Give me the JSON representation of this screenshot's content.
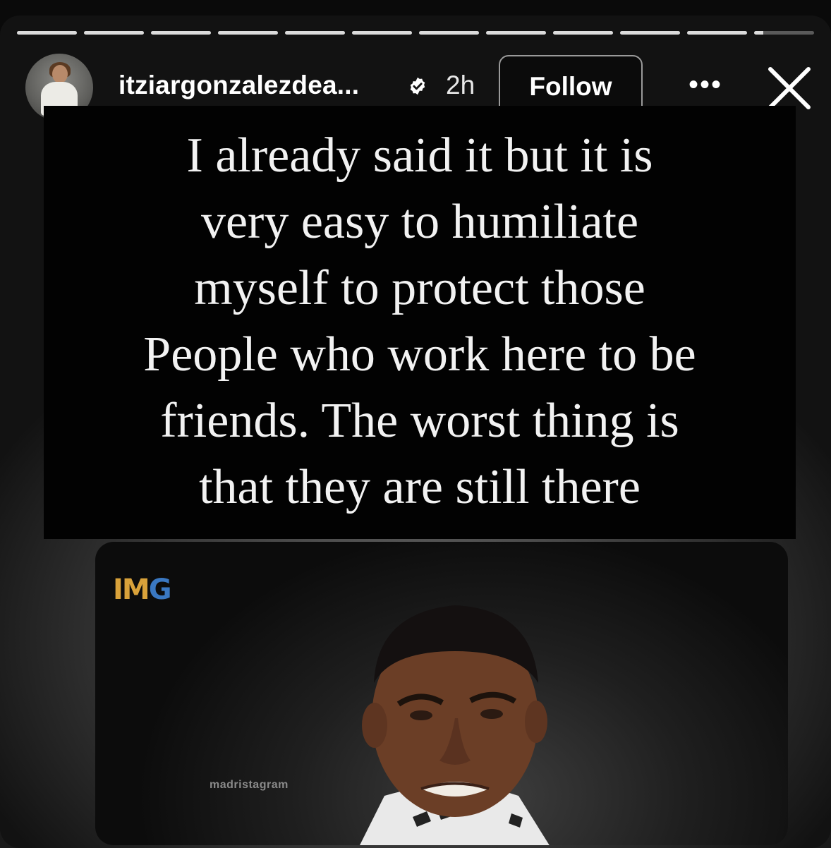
{
  "story": {
    "progress_segments": 12,
    "progress_active_fraction": 0.15,
    "header": {
      "username": "itziargonzalezdea...",
      "time": "2h",
      "follow_label": "Follow",
      "more_label": "•••"
    },
    "text": "I already said it but it is\nvery easy to humiliate\nmyself to protect those\nPeople who work here to be\nfriends. The worst thing is\nthat they are still there",
    "embedded_image": {
      "logo_text_main": "IM",
      "logo_text_accent": "G",
      "watermark": "madristagram"
    }
  },
  "colors": {
    "text_card_bg": "#020202",
    "logo_gold": "#d9a23a",
    "logo_blue": "#3a78c2"
  }
}
